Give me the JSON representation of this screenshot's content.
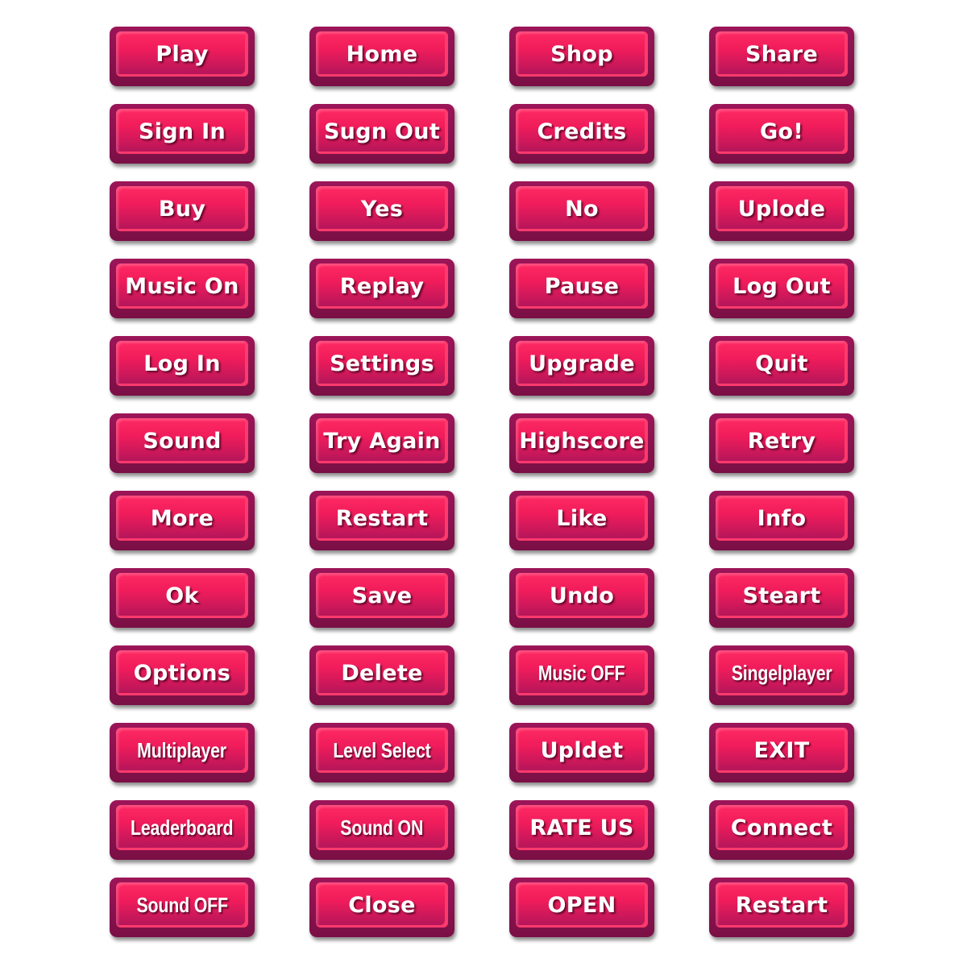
{
  "buttons": [
    "Play",
    "Home",
    "Shop",
    "Share",
    "Sign In",
    "Sugn Out",
    "Credits",
    "Go!",
    "Buy",
    "Yes",
    "No",
    "Uplode",
    "Music On",
    "Replay",
    "Pause",
    "Log Out",
    "Log In",
    "Settings",
    "Upgrade",
    "Quit",
    "Sound",
    "Try Again",
    "Highscore",
    "Retry",
    "More",
    "Restart",
    "Like",
    "Info",
    "Ok",
    "Save",
    "Undo",
    "Steart",
    "Options",
    "Delete",
    "Music OFF",
    "Singelplayer",
    "Multiplayer",
    "Level Select",
    "Upldet",
    "EXIT",
    "Leaderboard",
    "Sound ON",
    "RATE US",
    "Connect",
    "Sound OFF",
    "Close",
    "OPEN",
    "Restart"
  ],
  "colors": {
    "button_base": "#8a1250",
    "button_face": "#ff2a63",
    "label": "#ffffff"
  }
}
